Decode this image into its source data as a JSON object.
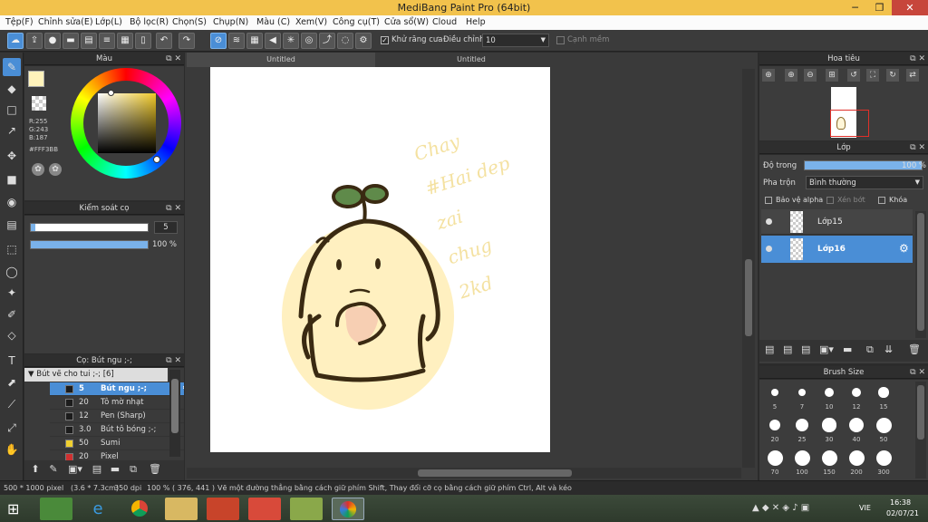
{
  "app": {
    "title": "MediBang Paint Pro (64bit)"
  },
  "menu": [
    "Tệp(F)",
    "Chỉnh sửa(E)",
    "Lớp(L)",
    "Bộ lọc(R)",
    "Chọn(S)",
    "Chụp(N)",
    "Màu (C)",
    "Xem(V)",
    "Công cụ(T)",
    "Cửa sổ(W)",
    "Cloud",
    "Help"
  ],
  "toolbar": {
    "antialias_label": "Khử răng cưa",
    "correction_label": "Điều chỉnh",
    "correction_value": "10",
    "soft_edge_label": "Cạnh mềm"
  },
  "tabs": [
    "Untitled",
    "Untitled"
  ],
  "color_panel": {
    "title": "Màu",
    "r": "R:255",
    "g": "G:243",
    "b": "B:187",
    "hex": "#FFF3BB",
    "primary_color": "#FFF3BB",
    "hue_color": "#f0c928"
  },
  "brush_control": {
    "title": "Kiểm soát cọ",
    "size_value": "5",
    "opacity_value": "100 %",
    "size_fraction": 0.04,
    "opacity_fraction": 1.0
  },
  "brush_panel": {
    "title": "Cọ: Bút ngu ;-;",
    "group": "Bút vẽ cho tui ;-; [6]",
    "items": [
      {
        "size": "5",
        "name": "Bút ngu ;-;",
        "color": "#1c1c1c"
      },
      {
        "size": "20",
        "name": "Tô mờ nhạt",
        "color": "#1c1c1c"
      },
      {
        "size": "12",
        "name": "Pen (Sharp)",
        "color": "#1c1c1c"
      },
      {
        "size": "3.0",
        "name": "Bút tô bóng ;-;",
        "color": "#1c1c1c"
      },
      {
        "size": "50",
        "name": "Sumi",
        "color": "#f0d030"
      },
      {
        "size": "20",
        "name": "Pixel",
        "color": "#d03030"
      }
    ]
  },
  "navigator": {
    "title": "Hoa tiêu"
  },
  "layers": {
    "title": "Lớp",
    "opacity_label": "Độ trong",
    "opacity_value": "100 %",
    "opacity_fraction": 1.0,
    "blend_label": "Pha trộn",
    "blend_value": "Bình thường",
    "protect_alpha": "Bảo vệ alpha",
    "clip": "Xén bớt",
    "lock": "Khóa",
    "items": [
      {
        "name": "Lớp15"
      },
      {
        "name": "Lớp16"
      }
    ]
  },
  "brush_size": {
    "title": "Brush Size",
    "sizes": [
      "5",
      "7",
      "10",
      "12",
      "15",
      "20",
      "25",
      "30",
      "40",
      "50",
      "70",
      "100",
      "150",
      "200",
      "300"
    ]
  },
  "canvas_text": {
    "handwriting": [
      "Chay",
      "#Hai dep",
      "zai",
      "chug",
      "2kd"
    ]
  },
  "status": {
    "dimensions": "500 * 1000 pixel",
    "size_cm": "(3.6 * 7.3cm)",
    "dpi": "350 dpi",
    "zoom": "100 %",
    "coords": "( 376, 441 )",
    "hint": "Vẽ một đường thẳng bằng cách giữ phím Shift, Thay đổi cỡ cọ bằng cách giữ phím Ctrl, Alt và kéo"
  },
  "taskbar": {
    "lang": "VIE",
    "time": "16:38",
    "date": "02/07/21"
  }
}
